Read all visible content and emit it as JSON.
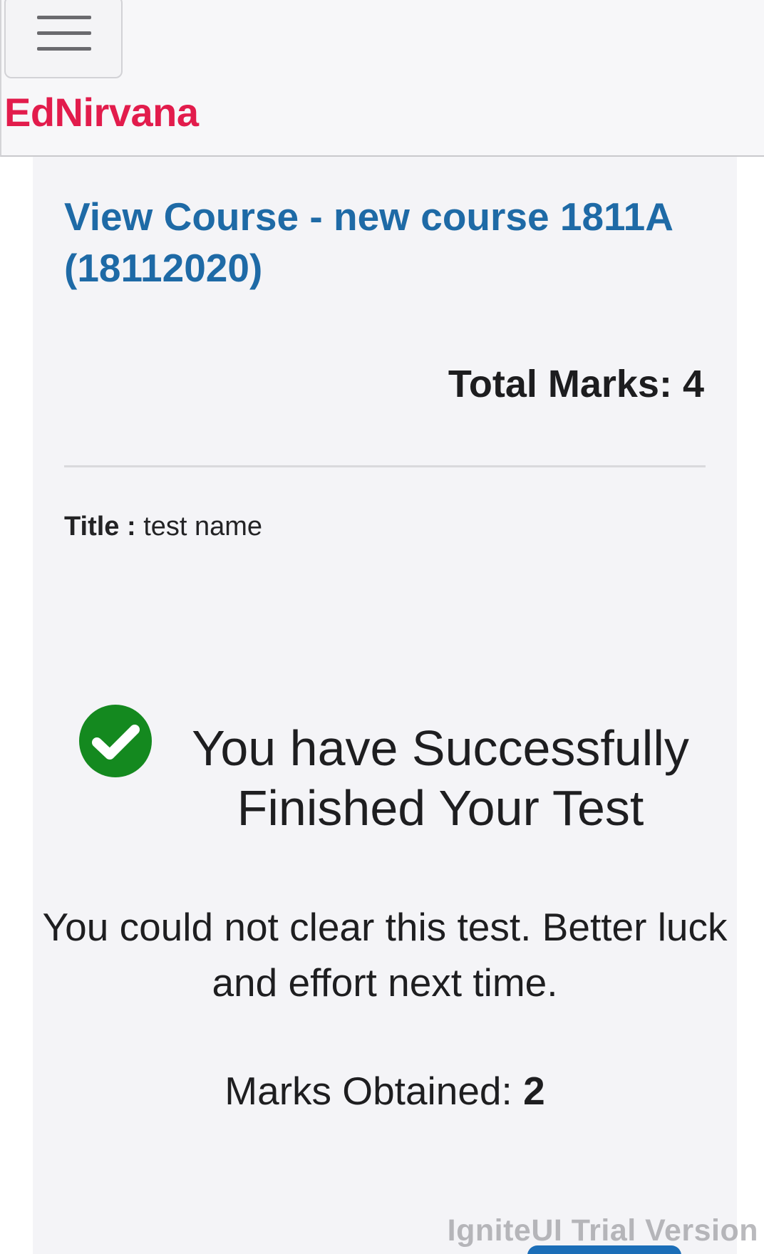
{
  "header": {
    "menu_icon": "hamburger-menu-icon",
    "brand": "EdNirvana",
    "brand_color": "#e21c4c"
  },
  "course": {
    "title": "View Course - new course 1811A (18112020)",
    "title_color": "#1e6aa6"
  },
  "marks": {
    "total_label": "Total Marks:",
    "total_value": "4"
  },
  "test": {
    "title_label": "Title :",
    "title_value": "test name"
  },
  "result": {
    "status_icon": "check-circle-icon",
    "status_color": "#14891f",
    "success_message": "You have Successfully Finished Your Test",
    "fail_message": "You could not clear this test. Better luck and effort next time.",
    "obtained_label": "Marks Obtained:",
    "obtained_value": "2"
  },
  "footer": {
    "watermark": "IgniteUI Trial Version",
    "button_color": "#1b6eb8"
  }
}
